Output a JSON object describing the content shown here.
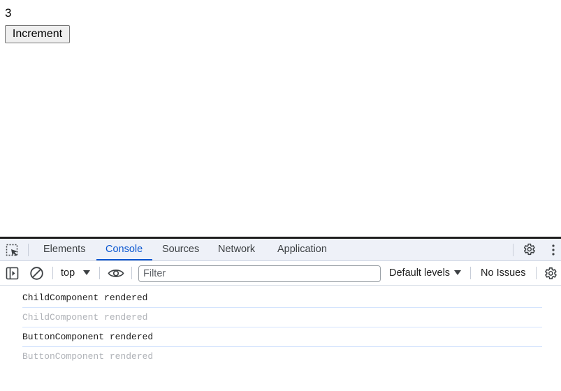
{
  "app": {
    "count": "3",
    "increment_label": "Increment"
  },
  "devtools": {
    "tabs": [
      {
        "label": "Elements",
        "active": false
      },
      {
        "label": "Console",
        "active": true
      },
      {
        "label": "Sources",
        "active": false
      },
      {
        "label": "Network",
        "active": false
      },
      {
        "label": "Application",
        "active": false
      }
    ],
    "toolbar": {
      "context": "top",
      "filter_placeholder": "Filter",
      "filter_value": "",
      "levels": "Default levels",
      "issues": "No Issues"
    },
    "console_messages": [
      {
        "text": "ChildComponent rendered",
        "style": "normal"
      },
      {
        "text": "ChildComponent rendered",
        "style": "dim"
      },
      {
        "text": "ButtonComponent rendered",
        "style": "normal"
      },
      {
        "text": "ButtonComponent rendered",
        "style": "dim"
      }
    ],
    "colors": {
      "accent": "#0b57d0",
      "tabbar_bg": "#eef1f8",
      "dim_text": "#b0b3b8",
      "row_separator": "#d3e3fd"
    },
    "icons": {
      "inspect": "inspect-element-icon",
      "sidebar": "sidebar-toggle-icon",
      "clear": "clear-console-icon",
      "live_expression": "eye-icon",
      "settings": "gear-icon",
      "more": "kebab-menu-icon"
    }
  }
}
